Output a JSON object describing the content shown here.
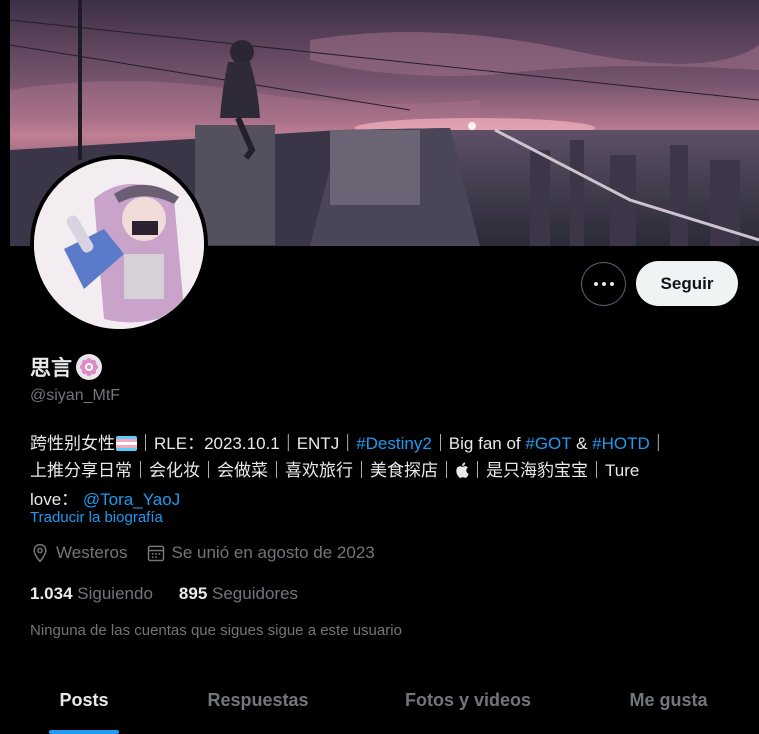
{
  "profile": {
    "display_name": "思言",
    "handle": "@siyan_MtF",
    "badge_icon": "flower-badge-icon"
  },
  "actions": {
    "more_icon": "more-options-icon",
    "follow_label": "Seguir"
  },
  "bio": {
    "line1_a": "跨性别女性",
    "line1_b": "｜RLE：2023.10.1｜ENTJ｜",
    "line1_tag1": "#Destiny2",
    "line1_c": "｜Big fan of ",
    "line1_tag2": "#GOT",
    "line1_d": " & ",
    "line1_tag3": "#HOTD",
    "line1_e": "｜",
    "line2_a": "上推分享日常｜会化妆｜会做菜｜喜欢旅行｜美食探店｜",
    "line2_b": "｜是只海豹宝宝｜Ture",
    "line3_a": "love：",
    "line3_mention": "@Tora_YaoJ"
  },
  "translate_label": "Traducir la biografía",
  "meta": {
    "location": "Westeros",
    "joined": "Se unió en agosto de 2023"
  },
  "stats": {
    "following_count": "1.034",
    "following_label": "Siguiendo",
    "followers_count": "895",
    "followers_label": "Seguidores"
  },
  "note": "Ninguna de las cuentas que sigues sigue a este usuario",
  "tabs": [
    {
      "label": "Posts",
      "active": true
    },
    {
      "label": "Respuestas",
      "active": false
    },
    {
      "label": "Fotos y videos",
      "active": false
    },
    {
      "label": "Me gusta",
      "active": false
    }
  ],
  "colors": {
    "accent": "#1d9bf0",
    "background": "#000000",
    "muted_text": "#71767b"
  }
}
